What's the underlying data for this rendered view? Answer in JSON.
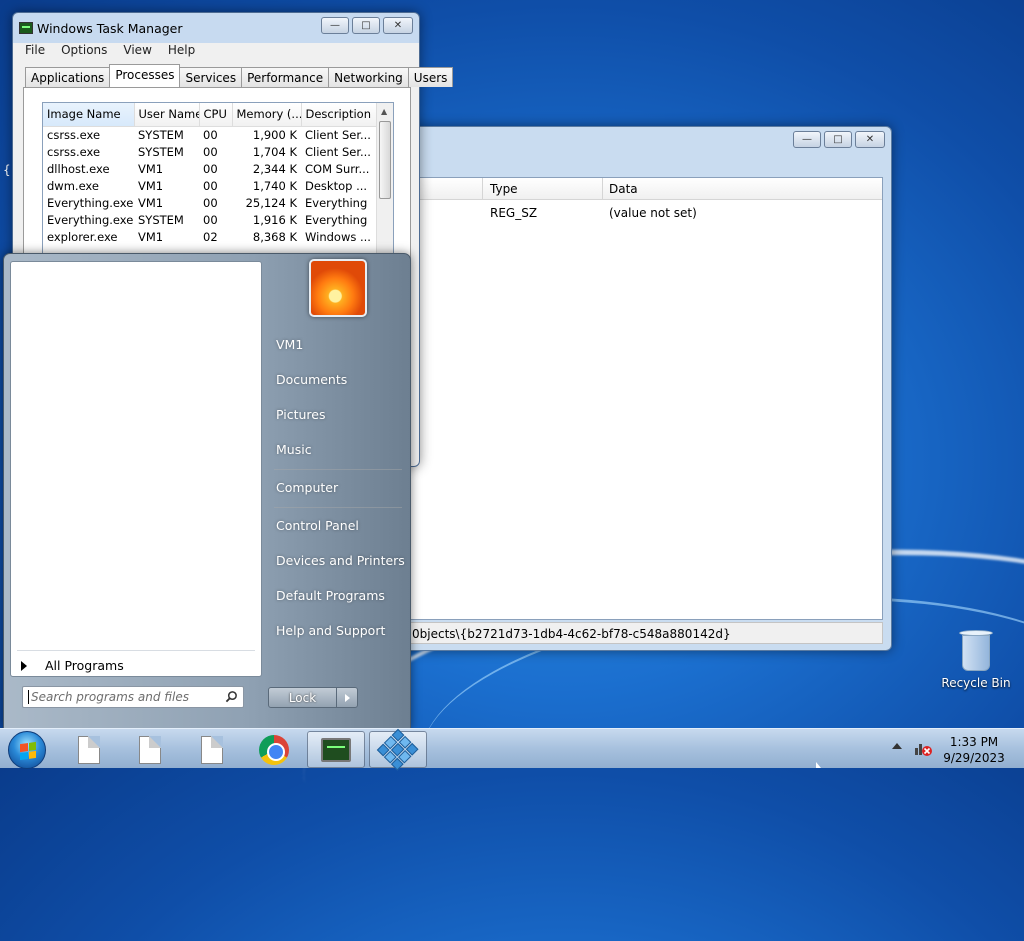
{
  "desktop": {
    "recycle_bin_label": "Recycle Bin",
    "stray_glyph": "{"
  },
  "task_manager": {
    "title": "Windows Task Manager",
    "menu": [
      "File",
      "Options",
      "View",
      "Help"
    ],
    "tabs": [
      "Applications",
      "Processes",
      "Services",
      "Performance",
      "Networking",
      "Users"
    ],
    "active_tab": "Processes",
    "columns": [
      "Image Name",
      "User Name",
      "CPU",
      "Memory (...",
      "Description"
    ],
    "rows": [
      [
        "csrss.exe",
        "SYSTEM",
        "00",
        "1,900 K",
        "Client Ser..."
      ],
      [
        "csrss.exe",
        "SYSTEM",
        "00",
        "1,704 K",
        "Client Ser..."
      ],
      [
        "dllhost.exe",
        "VM1",
        "00",
        "2,344 K",
        "COM Surr..."
      ],
      [
        "dwm.exe",
        "VM1",
        "00",
        "1,740 K",
        "Desktop ..."
      ],
      [
        "Everything.exe",
        "VM1",
        "00",
        "25,124 K",
        "Everything"
      ],
      [
        "Everything.exe",
        "SYSTEM",
        "00",
        "1,916 K",
        "Everything"
      ],
      [
        "explorer.exe",
        "VM1",
        "02",
        "8,368 K",
        "Windows ..."
      ]
    ]
  },
  "registry": {
    "columns": [
      "Type",
      "Data"
    ],
    "row": {
      "type": "REG_SZ",
      "data": "(value not set)"
    },
    "status_path": "0bjects\\{b2721d73-1db4-4c62-bf78-c548a880142d}"
  },
  "start_menu": {
    "user": "VM1",
    "right_items": [
      "Documents",
      "Pictures",
      "Music",
      "Computer",
      "Control Panel",
      "Devices and Printers",
      "Default Programs",
      "Help and Support"
    ],
    "all_programs": "All Programs",
    "search_placeholder": "Search programs and files",
    "lock_label": "Lock"
  },
  "taskbar": {
    "time": "1:33 PM",
    "date": "9/29/2023"
  },
  "window_buttons": {
    "minimize": "—",
    "maximize": "□",
    "close": "✕"
  }
}
